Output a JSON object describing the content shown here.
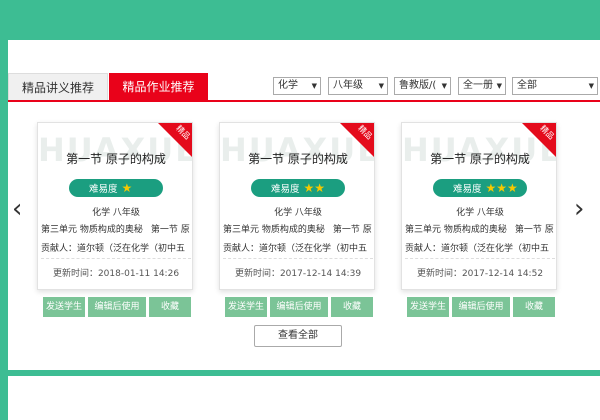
{
  "tabs": [
    "精品讲义推荐",
    "精品作业推荐"
  ],
  "filters": [
    "化学",
    "八年级",
    "鲁教版/(",
    "全一册",
    "全部"
  ],
  "cards": [
    {
      "watermark": "HUAXUE",
      "ribbon": "精品",
      "title": "第一节 原子的构成",
      "difficulty_label": "难易度",
      "stars": "★",
      "subject": "化学  八年级",
      "unit": "第三单元 物质构成的奥秘",
      "section": "第一节 原",
      "contributor": "贡献人：道尔顿（泛在化学（初中五",
      "time": "更新时间：2018-01-11 14:26"
    },
    {
      "watermark": "HUAXUE",
      "ribbon": "精品",
      "title": "第一节 原子的构成",
      "difficulty_label": "难易度",
      "stars": "★★",
      "subject": "化学  八年级",
      "unit": "第三单元 物质构成的奥秘",
      "section": "第一节 原",
      "contributor": "贡献人：道尔顿（泛在化学（初中五",
      "time": "更新时间：2017-12-14 14:39"
    },
    {
      "watermark": "HUAXUE",
      "ribbon": "精品",
      "title": "第一节 原子的构成",
      "difficulty_label": "难易度",
      "stars": "★★★",
      "subject": "化学  八年级",
      "unit": "第三单元 物质构成的奥秘",
      "section": "第一节 原",
      "contributor": "贡献人：道尔顿（泛在化学（初中五",
      "time": "更新时间：2017-12-14 14:52"
    }
  ],
  "actions": [
    "发送学生",
    "编辑后使用",
    "收藏"
  ],
  "nav": {
    "prev": "‹",
    "next": "›"
  },
  "view_all": "查看全部",
  "colors": {
    "background": "#3dbd93",
    "active_tab": "#e9021a",
    "difficulty_badge": "#1b9e80",
    "action_button": "#7bc497",
    "star": "#f6c800"
  },
  "icons": [
    "chevron-left-icon",
    "chevron-right-icon",
    "star-icon",
    "dropdown-arrow-icon"
  ]
}
